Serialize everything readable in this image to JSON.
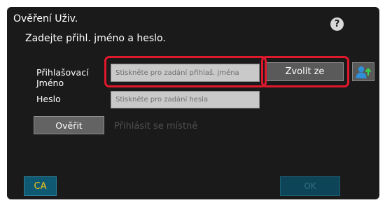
{
  "dialog": {
    "title": "Ověření Uživ.",
    "help_icon": "?",
    "instruction": "Zadejte přihl. jméno a heslo."
  },
  "form": {
    "username_label_line1": "Přihlašovací",
    "username_label_line2": "Jméno",
    "username_placeholder": "Stiskněte pro zadání přihlaš. jména",
    "password_label": "Heslo",
    "password_placeholder": "Stiskněte pro zadání hesla",
    "select_button_label": "Zvolit ze",
    "address_book_icon": "user-select-icon"
  },
  "actions": {
    "verify_label": "Ověřit",
    "local_login_label": "Přihlásit se místně",
    "ca_label": "CA",
    "ok_label": "OK"
  },
  "colors": {
    "background": "#1a1a1a",
    "highlight": "#e0182b",
    "ca_text": "#f1c21b",
    "button_teal": "#0f5a72"
  }
}
